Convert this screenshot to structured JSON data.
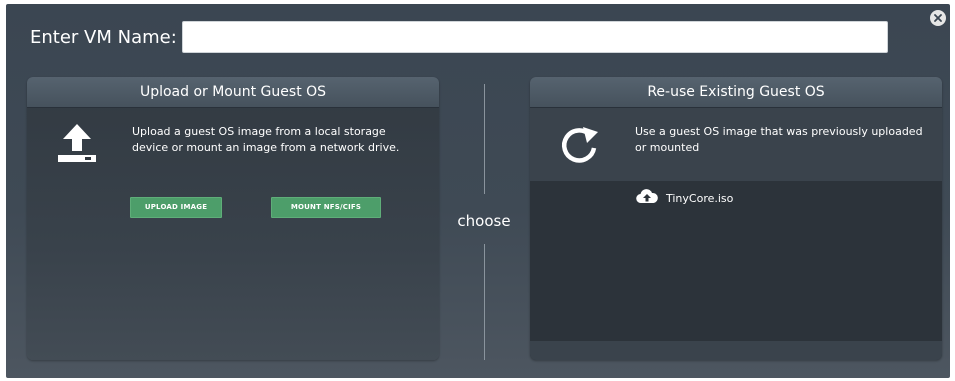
{
  "header": {
    "name_label": "Enter VM Name:",
    "name_value": "",
    "name_placeholder": ""
  },
  "left_panel": {
    "title": "Upload or Mount Guest OS",
    "description": "Upload a guest OS image from a local storage device or mount an image from a network drive.",
    "icon": "upload-icon",
    "buttons": {
      "upload": "UPLOAD IMAGE",
      "mount": "MOUNT NFS/CIFS"
    }
  },
  "separator": {
    "label": "choose"
  },
  "right_panel": {
    "title": "Re-use Existing Guest OS",
    "description": "Use a guest OS image that was previously uploaded or mounted",
    "icon": "refresh-icon",
    "images": [
      {
        "name": "TinyCore.iso",
        "icon": "cloud-upload-icon"
      }
    ]
  },
  "colors": {
    "dialog_bg": "#3f4a55",
    "panel_bg": "#2f363d",
    "button_green": "#4d9e6a"
  }
}
